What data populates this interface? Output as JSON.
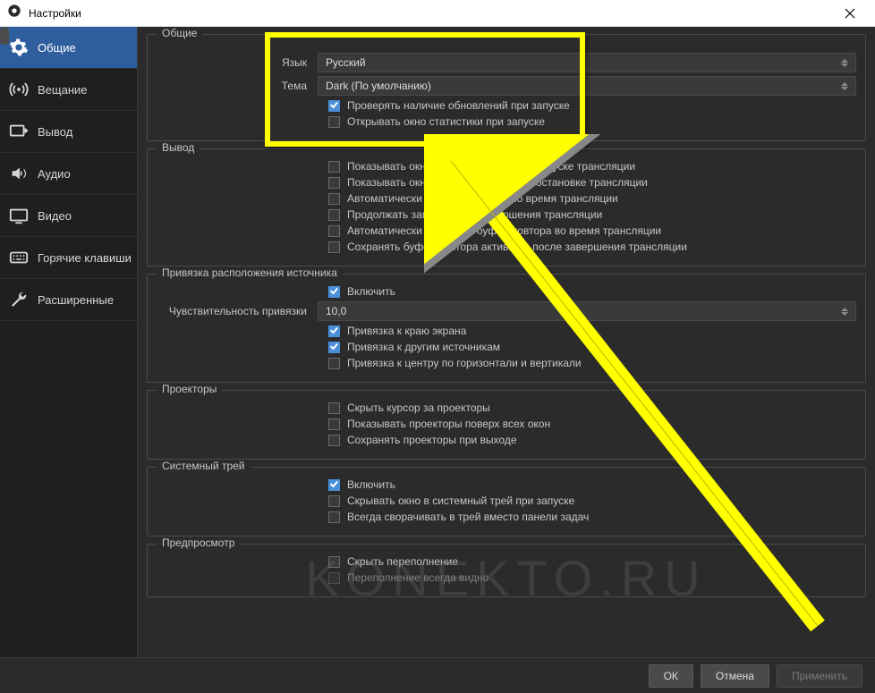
{
  "window": {
    "title": "Настройки"
  },
  "sidebar": {
    "items": [
      {
        "label": "Общие"
      },
      {
        "label": "Вещание"
      },
      {
        "label": "Вывод"
      },
      {
        "label": "Аудио"
      },
      {
        "label": "Видео"
      },
      {
        "label": "Горячие клавиши"
      },
      {
        "label": "Расширенные"
      }
    ]
  },
  "groups": {
    "general": {
      "title": "Общие",
      "lang_label": "Язык",
      "lang_value": "Русский",
      "theme_label": "Тема",
      "theme_value": "Dark (По умолчанию)",
      "chk_updates": "Проверять наличие обновлений при запуске",
      "chk_stats": "Открывать окно статистики при запуске"
    },
    "output": {
      "title": "Вывод",
      "c1": "Показывать окно подтверждения при запуске трансляции",
      "c2": "Показывать окно подтверждения при остановке трансляции",
      "c3": "Автоматически включать запись во время трансляции",
      "c4": "Продолжать запись после завершения трансляции",
      "c5": "Автоматически запускать буфер повтора во время трансляции",
      "c6": "Сохранять буфер повтора активным после завершения трансляции"
    },
    "snap": {
      "title": "Привязка расположения источника",
      "c1": "Включить",
      "sens_label": "Чувствительность привязки",
      "sens_value": "10,0",
      "c2": "Привязка к краю экрана",
      "c3": "Привязка к другим источникам",
      "c4": "Привязка к центру по горизонтали и вертикали"
    },
    "proj": {
      "title": "Проекторы",
      "c1": "Скрыть курсор за проекторы",
      "c2": "Показывать проекторы поверх всех окон",
      "c3": "Сохранять проекторы при выходе"
    },
    "tray": {
      "title": "Системный трей",
      "c1": "Включить",
      "c2": "Скрывать окно в системный трей при запуске",
      "c3": "Всегда сворачивать в трей вместо панели задач"
    },
    "preview": {
      "title": "Предпросмотр",
      "c1": "Скрыть переполнение",
      "c2": "Переполнение всегда видно"
    }
  },
  "bottom": {
    "ok": "ОК",
    "cancel": "Отмена",
    "apply": "Применить"
  },
  "watermark": "KONEKTO.RU"
}
